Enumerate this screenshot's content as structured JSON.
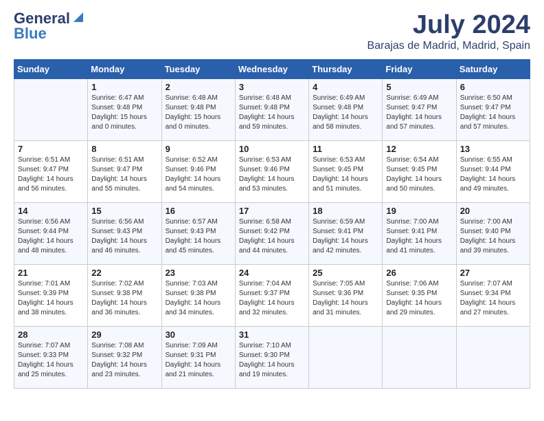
{
  "header": {
    "logo_general": "General",
    "logo_blue": "Blue",
    "main_title": "July 2024",
    "subtitle": "Barajas de Madrid, Madrid, Spain"
  },
  "calendar": {
    "days_of_week": [
      "Sunday",
      "Monday",
      "Tuesday",
      "Wednesday",
      "Thursday",
      "Friday",
      "Saturday"
    ],
    "weeks": [
      [
        {
          "day": "",
          "info": ""
        },
        {
          "day": "1",
          "info": "Sunrise: 6:47 AM\nSunset: 9:48 PM\nDaylight: 15 hours\nand 0 minutes."
        },
        {
          "day": "2",
          "info": "Sunrise: 6:48 AM\nSunset: 9:48 PM\nDaylight: 15 hours\nand 0 minutes."
        },
        {
          "day": "3",
          "info": "Sunrise: 6:48 AM\nSunset: 9:48 PM\nDaylight: 14 hours\nand 59 minutes."
        },
        {
          "day": "4",
          "info": "Sunrise: 6:49 AM\nSunset: 9:48 PM\nDaylight: 14 hours\nand 58 minutes."
        },
        {
          "day": "5",
          "info": "Sunrise: 6:49 AM\nSunset: 9:47 PM\nDaylight: 14 hours\nand 57 minutes."
        },
        {
          "day": "6",
          "info": "Sunrise: 6:50 AM\nSunset: 9:47 PM\nDaylight: 14 hours\nand 57 minutes."
        }
      ],
      [
        {
          "day": "7",
          "info": "Sunrise: 6:51 AM\nSunset: 9:47 PM\nDaylight: 14 hours\nand 56 minutes."
        },
        {
          "day": "8",
          "info": "Sunrise: 6:51 AM\nSunset: 9:47 PM\nDaylight: 14 hours\nand 55 minutes."
        },
        {
          "day": "9",
          "info": "Sunrise: 6:52 AM\nSunset: 9:46 PM\nDaylight: 14 hours\nand 54 minutes."
        },
        {
          "day": "10",
          "info": "Sunrise: 6:53 AM\nSunset: 9:46 PM\nDaylight: 14 hours\nand 53 minutes."
        },
        {
          "day": "11",
          "info": "Sunrise: 6:53 AM\nSunset: 9:45 PM\nDaylight: 14 hours\nand 51 minutes."
        },
        {
          "day": "12",
          "info": "Sunrise: 6:54 AM\nSunset: 9:45 PM\nDaylight: 14 hours\nand 50 minutes."
        },
        {
          "day": "13",
          "info": "Sunrise: 6:55 AM\nSunset: 9:44 PM\nDaylight: 14 hours\nand 49 minutes."
        }
      ],
      [
        {
          "day": "14",
          "info": "Sunrise: 6:56 AM\nSunset: 9:44 PM\nDaylight: 14 hours\nand 48 minutes."
        },
        {
          "day": "15",
          "info": "Sunrise: 6:56 AM\nSunset: 9:43 PM\nDaylight: 14 hours\nand 46 minutes."
        },
        {
          "day": "16",
          "info": "Sunrise: 6:57 AM\nSunset: 9:43 PM\nDaylight: 14 hours\nand 45 minutes."
        },
        {
          "day": "17",
          "info": "Sunrise: 6:58 AM\nSunset: 9:42 PM\nDaylight: 14 hours\nand 44 minutes."
        },
        {
          "day": "18",
          "info": "Sunrise: 6:59 AM\nSunset: 9:41 PM\nDaylight: 14 hours\nand 42 minutes."
        },
        {
          "day": "19",
          "info": "Sunrise: 7:00 AM\nSunset: 9:41 PM\nDaylight: 14 hours\nand 41 minutes."
        },
        {
          "day": "20",
          "info": "Sunrise: 7:00 AM\nSunset: 9:40 PM\nDaylight: 14 hours\nand 39 minutes."
        }
      ],
      [
        {
          "day": "21",
          "info": "Sunrise: 7:01 AM\nSunset: 9:39 PM\nDaylight: 14 hours\nand 38 minutes."
        },
        {
          "day": "22",
          "info": "Sunrise: 7:02 AM\nSunset: 9:38 PM\nDaylight: 14 hours\nand 36 minutes."
        },
        {
          "day": "23",
          "info": "Sunrise: 7:03 AM\nSunset: 9:38 PM\nDaylight: 14 hours\nand 34 minutes."
        },
        {
          "day": "24",
          "info": "Sunrise: 7:04 AM\nSunset: 9:37 PM\nDaylight: 14 hours\nand 32 minutes."
        },
        {
          "day": "25",
          "info": "Sunrise: 7:05 AM\nSunset: 9:36 PM\nDaylight: 14 hours\nand 31 minutes."
        },
        {
          "day": "26",
          "info": "Sunrise: 7:06 AM\nSunset: 9:35 PM\nDaylight: 14 hours\nand 29 minutes."
        },
        {
          "day": "27",
          "info": "Sunrise: 7:07 AM\nSunset: 9:34 PM\nDaylight: 14 hours\nand 27 minutes."
        }
      ],
      [
        {
          "day": "28",
          "info": "Sunrise: 7:07 AM\nSunset: 9:33 PM\nDaylight: 14 hours\nand 25 minutes."
        },
        {
          "day": "29",
          "info": "Sunrise: 7:08 AM\nSunset: 9:32 PM\nDaylight: 14 hours\nand 23 minutes."
        },
        {
          "day": "30",
          "info": "Sunrise: 7:09 AM\nSunset: 9:31 PM\nDaylight: 14 hours\nand 21 minutes."
        },
        {
          "day": "31",
          "info": "Sunrise: 7:10 AM\nSunset: 9:30 PM\nDaylight: 14 hours\nand 19 minutes."
        },
        {
          "day": "",
          "info": ""
        },
        {
          "day": "",
          "info": ""
        },
        {
          "day": "",
          "info": ""
        }
      ]
    ]
  }
}
